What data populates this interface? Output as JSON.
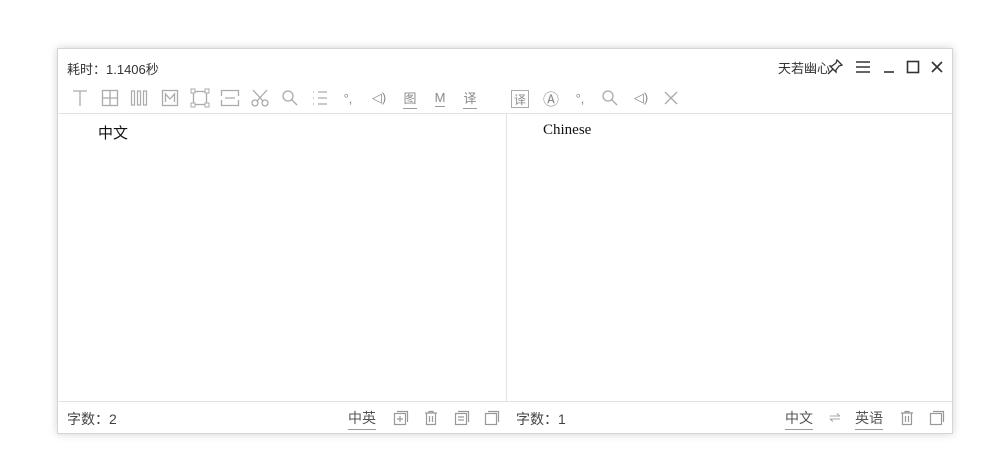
{
  "titlebar": {
    "elapsed": "耗时：1.1406秒",
    "brand": "天若幽心"
  },
  "toolbar": {
    "tools": [
      {
        "name": "text-icon"
      },
      {
        "name": "table-icon"
      },
      {
        "name": "vertical-text-icon"
      },
      {
        "name": "markdown-box-icon"
      },
      {
        "name": "select-area-icon"
      },
      {
        "name": "split-icon"
      },
      {
        "name": "scissors-icon"
      },
      {
        "name": "search-icon"
      },
      {
        "name": "list-icon"
      },
      {
        "name": "punctuation-icon",
        "label": "°,"
      },
      {
        "name": "speaker-icon",
        "label": "◁)"
      },
      {
        "name": "image-icon",
        "label": "图"
      },
      {
        "name": "markdown-icon",
        "label": "M"
      },
      {
        "name": "translate-icon",
        "label": "译"
      },
      {
        "name": "translate-box-icon",
        "label": "译"
      },
      {
        "name": "font-a-icon",
        "label": "Ⓐ"
      },
      {
        "name": "punctuation-icon-right",
        "label": "°,"
      },
      {
        "name": "search-icon-right"
      },
      {
        "name": "speaker-icon-right",
        "label": "◁)"
      },
      {
        "name": "close-icon-right"
      }
    ]
  },
  "left_pane": {
    "text": "中文",
    "count_label": "字数：2",
    "lang_label": "中英"
  },
  "right_pane": {
    "text": "Chinese",
    "count_label": "字数：1",
    "source_lang": "中文",
    "target_lang": "英语",
    "swap": "⇌"
  }
}
